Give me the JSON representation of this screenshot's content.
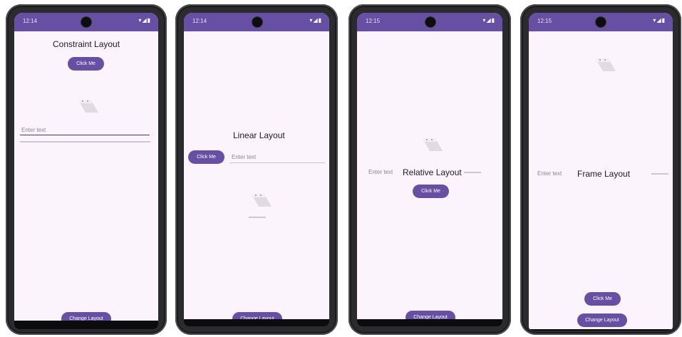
{
  "colors": {
    "status_bar": "#6750a4",
    "screen_bg": "#fbf4fd",
    "button": "#6750a4",
    "button_text": "#ffffff"
  },
  "screens": [
    {
      "time": "12:14",
      "status_icons": "▾◢▮",
      "title": "Constraint Layout",
      "button_label": "Click Me",
      "input_placeholder": "Enter text",
      "change_layout_label": "Change Layout"
    },
    {
      "time": "12:14",
      "status_icons": "▾◢▮",
      "title": "Linear Layout",
      "button_label": "Click Me",
      "input_placeholder": "Enter text",
      "change_layout_label": "Change Layout"
    },
    {
      "time": "12:15",
      "status_icons": "▾◢▮",
      "title": "Relative Layout",
      "button_label": "Click Me",
      "input_placeholder": "Enter text",
      "change_layout_label": "Change Layout"
    },
    {
      "time": "12:15",
      "status_icons": "▾◢▮",
      "title": "Frame Layout",
      "button_label": "Click Me",
      "input_placeholder": "Enter text",
      "change_layout_label": "Change Layout"
    }
  ]
}
